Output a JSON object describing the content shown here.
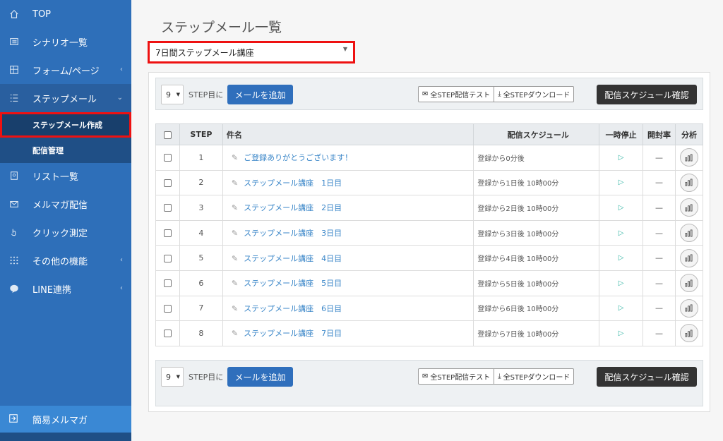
{
  "sidebar": {
    "items": [
      {
        "label": "TOP",
        "icon": "home-icon"
      },
      {
        "label": "シナリオ一覧",
        "icon": "list-icon"
      },
      {
        "label": "フォーム/ページ",
        "icon": "form-icon",
        "chevron": "‹"
      },
      {
        "label": "ステップメール",
        "icon": "steps-icon",
        "chevron": "⌄"
      },
      {
        "label": "リスト一覧",
        "icon": "address-icon"
      },
      {
        "label": "メルマガ配信",
        "icon": "mail-icon"
      },
      {
        "label": "クリック測定",
        "icon": "click-icon"
      },
      {
        "label": "その他の機能",
        "icon": "grid-icon",
        "chevron": "‹"
      },
      {
        "label": "LINE連携",
        "icon": "line-icon",
        "chevron": "‹"
      }
    ],
    "sub_items": [
      {
        "label": "ステップメール作成"
      },
      {
        "label": "配信管理"
      }
    ],
    "bottom": {
      "label": "簡易メルマガ",
      "icon": "exit-icon"
    }
  },
  "main": {
    "title": "ステップメール一覧",
    "scenario_value": "7日間ステップメール講座",
    "toolbar": {
      "step_value": "9",
      "step_label": "STEP目に",
      "add_label": "メールを追加",
      "test_label": "全STEP配信テスト",
      "download_label": "全STEPダウンロード",
      "schedule_label": "配信スケジュール確認"
    },
    "table": {
      "headers": {
        "step": "STEP",
        "name": "件名",
        "schedule": "配信スケジュール",
        "pause": "一時停止",
        "open": "開封率",
        "analysis": "分析"
      },
      "rows": [
        {
          "step": "1",
          "name": "ご登録ありがとうございます！",
          "schedule": "登録から0分後",
          "pause": "▷",
          "open": "—"
        },
        {
          "step": "2",
          "name": "ステップメール講座　1日目",
          "schedule": "登録から1日後 10時00分",
          "pause": "▷",
          "open": "—"
        },
        {
          "step": "3",
          "name": "ステップメール講座　2日目",
          "schedule": "登録から2日後 10時00分",
          "pause": "▷",
          "open": "—"
        },
        {
          "step": "4",
          "name": "ステップメール講座　3日目",
          "schedule": "登録から3日後 10時00分",
          "pause": "▷",
          "open": "—"
        },
        {
          "step": "5",
          "name": "ステップメール講座　4日目",
          "schedule": "登録から4日後 10時00分",
          "pause": "▷",
          "open": "—"
        },
        {
          "step": "6",
          "name": "ステップメール講座　5日目",
          "schedule": "登録から5日後 10時00分",
          "pause": "▷",
          "open": "—"
        },
        {
          "step": "7",
          "name": "ステップメール講座　6日目",
          "schedule": "登録から6日後 10時00分",
          "pause": "▷",
          "open": "—"
        },
        {
          "step": "8",
          "name": "ステップメール講座　7日目",
          "schedule": "登録から7日後 10時00分",
          "pause": "▷",
          "open": "—"
        }
      ]
    }
  },
  "colors": {
    "sidebar": "#2e6fb9",
    "accent_button": "#2f6fbc",
    "highlight": "#e11111"
  }
}
